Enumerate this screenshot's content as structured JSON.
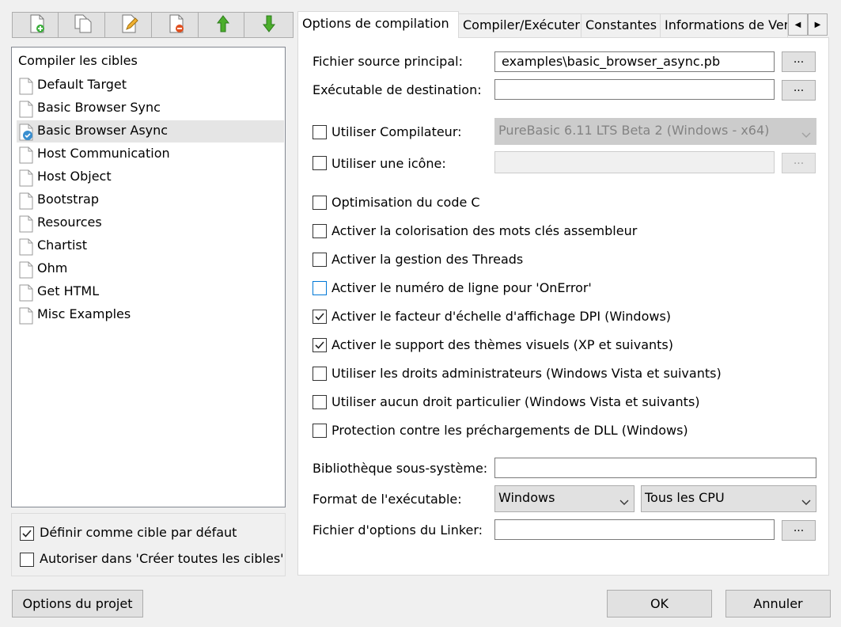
{
  "toolbar": {
    "buttons": [
      {
        "icon": "new-target-icon"
      },
      {
        "icon": "copy-target-icon"
      },
      {
        "icon": "edit-target-icon"
      },
      {
        "icon": "remove-target-icon"
      },
      {
        "icon": "move-up-icon"
      },
      {
        "icon": "move-down-icon"
      }
    ]
  },
  "targets": {
    "title": "Compiler les cibles",
    "items": [
      {
        "label": "Default Target",
        "selected": false
      },
      {
        "label": "Basic Browser Sync",
        "selected": false
      },
      {
        "label": "Basic Browser Async",
        "selected": true,
        "default": true
      },
      {
        "label": "Host Communication",
        "selected": false
      },
      {
        "label": "Host Object",
        "selected": false
      },
      {
        "label": "Bootstrap",
        "selected": false
      },
      {
        "label": "Resources",
        "selected": false
      },
      {
        "label": "Chartist",
        "selected": false
      },
      {
        "label": "Ohm",
        "selected": false
      },
      {
        "label": "Get HTML",
        "selected": false
      },
      {
        "label": "Misc Examples",
        "selected": false
      }
    ],
    "default_target": {
      "label": "Définir comme cible par défaut",
      "checked": true
    },
    "allow_build_all": {
      "label": "Autoriser dans 'Créer toutes les cibles'",
      "checked": false
    }
  },
  "tabs": [
    {
      "label": "Options de compilation",
      "active": true
    },
    {
      "label": "Compiler/Exécuter",
      "active": false
    },
    {
      "label": "Constantes",
      "active": false
    },
    {
      "label": "Informations de Version",
      "active": false
    }
  ],
  "compile": {
    "source_label": "Fichier source principal:",
    "source_value": "examples\\basic_browser_async.pb",
    "output_label": "Exécutable de destination:",
    "output_value": "",
    "browse_label": "...",
    "use_compiler": {
      "label": "Utiliser Compilateur:",
      "checked": false
    },
    "compiler_value": "PureBasic 6.11 LTS Beta 2 (Windows - x64)",
    "use_icon": {
      "label": "Utiliser une icône:",
      "checked": false
    },
    "icon_value": "",
    "options": [
      {
        "label": "Optimisation du code C",
        "checked": false,
        "focused": false
      },
      {
        "label": "Activer la colorisation des mots clés assembleur",
        "checked": false,
        "focused": false
      },
      {
        "label": "Activer la gestion des Threads",
        "checked": false,
        "focused": false
      },
      {
        "label": "Activer le numéro de ligne pour 'OnError'",
        "checked": false,
        "focused": true
      },
      {
        "label": "Activer le facteur d'échelle d'affichage DPI (Windows)",
        "checked": true,
        "focused": false
      },
      {
        "label": "Activer le support des thèmes visuels (XP et suivants)",
        "checked": true,
        "focused": false
      },
      {
        "label": "Utiliser les droits administrateurs (Windows Vista et suivants)",
        "checked": false,
        "focused": false
      },
      {
        "label": "Utiliser aucun droit particulier (Windows Vista et suivants)",
        "checked": false,
        "focused": false
      },
      {
        "label": "Protection contre les préchargements de DLL (Windows)",
        "checked": false,
        "focused": false
      }
    ],
    "subsystem_label": "Bibliothèque sous-système:",
    "subsystem_value": "",
    "format_label": "Format de l'exécutable:",
    "format_value": "Windows",
    "cpu_value": "Tous les CPU",
    "linker_label": "Fichier d'options du Linker:",
    "linker_value": ""
  },
  "footer": {
    "project_options": "Options du projet",
    "ok": "OK",
    "cancel": "Annuler"
  }
}
